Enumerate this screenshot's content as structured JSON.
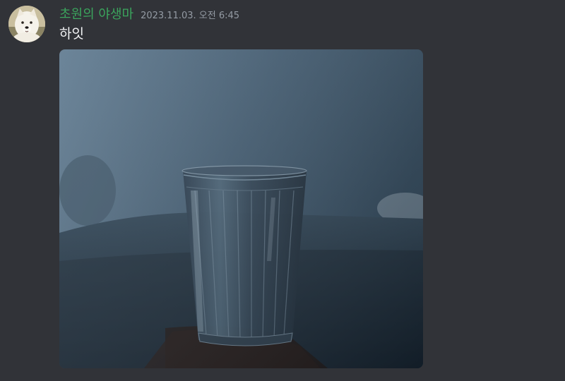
{
  "message": {
    "author": "초원의 야생마",
    "timestamp": "2023.11.03. 오전 6:45",
    "content": "하잇",
    "avatar_icon": "white-dog-avatar",
    "attachment": {
      "icon": "glass-of-water-image"
    }
  },
  "colors": {
    "background": "#313338",
    "username": "#3ba55d",
    "timestamp": "#949ba4",
    "text": "#f2f3f5"
  }
}
